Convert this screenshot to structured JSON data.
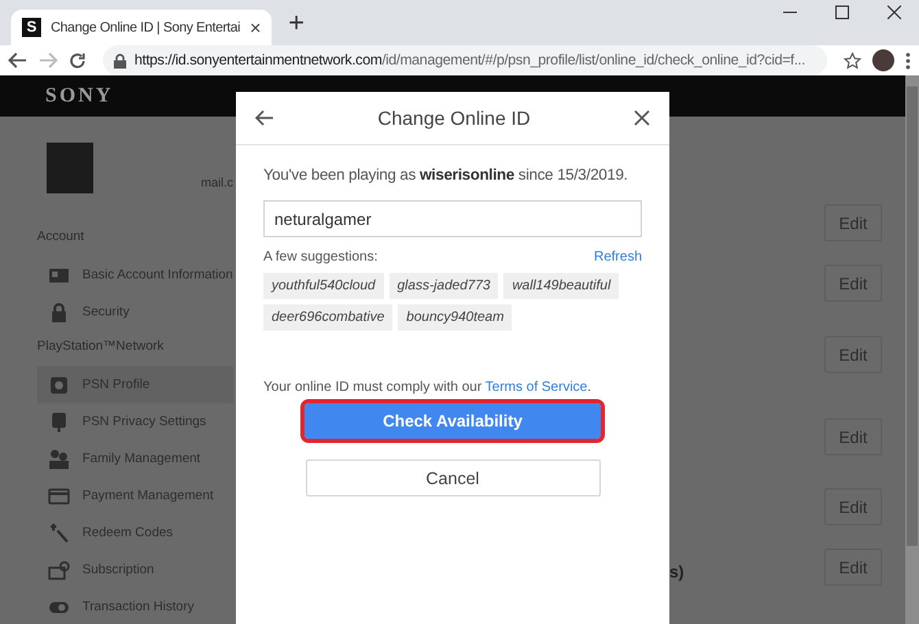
{
  "browser": {
    "tab": {
      "favicon": "S",
      "title": "Change Online ID | Sony Entertai",
      "close": "×"
    },
    "new_tab": "+",
    "url_host": "https://id.sonyentertainmentnetwork.com",
    "url_path": "/id/management/#/p/psn_profile/list/online_id/check_online_id?cid=f..."
  },
  "site": {
    "brand": "SONY",
    "email_fragment": "mail.c",
    "sections": [
      {
        "heading": "Account",
        "items": [
          {
            "label": "Basic Account Information",
            "selected": false
          },
          {
            "label": "Security",
            "selected": false
          }
        ]
      },
      {
        "heading": "PlayStation™Network",
        "items": [
          {
            "label": "PSN Profile",
            "selected": true
          },
          {
            "label": "PSN Privacy Settings",
            "selected": false
          },
          {
            "label": "Family Management",
            "selected": false
          },
          {
            "label": "Payment Management",
            "selected": false
          },
          {
            "label": "Redeem Codes",
            "selected": false
          },
          {
            "label": "Subscription",
            "selected": false
          },
          {
            "label": "Transaction History",
            "selected": false
          }
        ]
      }
    ],
    "edit_buttons": [
      "Edit",
      "Edit",
      "Edit",
      "Edit",
      "Edit",
      "Edit"
    ],
    "partial_text": "s)"
  },
  "modal": {
    "title": "Change Online ID",
    "intro": "You've been playing as **wiserisonline** since 15/3/2019.",
    "online_id_value": "neturalgamer",
    "suggestions_label": "A few suggestions:",
    "refresh": "Refresh",
    "suggestions": [
      "youthful540cloud",
      "glass-jaded773",
      "wall149beautiful",
      "deer696combative",
      "bouncy940team"
    ],
    "terms_text": "Your online ID must comply with our",
    "terms_link": "Terms of Service",
    "terms_end": ".",
    "check_button": {
      "label": "Check Availability",
      "focused": true
    },
    "cancel_button": "Cancel"
  }
}
